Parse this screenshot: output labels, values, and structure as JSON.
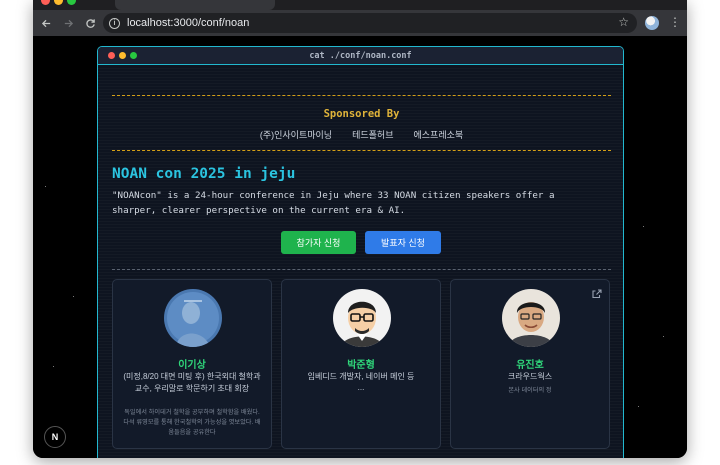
{
  "browser": {
    "url": "localhost:3000/conf/noan"
  },
  "terminal": {
    "title": "cat ./conf/noan.conf"
  },
  "sponsors": {
    "heading": "Sponsored By",
    "items": [
      "(주)인사이트마이닝",
      "테드폴허브",
      "에스프레소북"
    ]
  },
  "conference": {
    "title": "NOAN con 2025 in jeju",
    "description": "\"NOANcon\" is a 24-hour conference in Jeju where 33 NOAN citizen speakers offer a sharper, clearer perspective on the current era & AI."
  },
  "actions": {
    "attendee_label": "참가자 신청",
    "speaker_label": "발표자 신청"
  },
  "speakers": [
    {
      "name": "이기상",
      "role": "(미정,8/20 대면 미팅 후) 한국외대 철학과 교수, 우리말로 학문하기 초대 회장",
      "bio": "독일에서 하이데거 철학을 공부하며 철학함을 배웠다. 다석 류영모를 통해 한국철학의 가능성을 엿보았다. 배움들음을 공유한다"
    },
    {
      "name": "박준형",
      "role": "임베디드 개발자, 네이버 메인 등",
      "bio": "..."
    },
    {
      "name": "유진호",
      "role": "크라우드웍스",
      "bio": "본사 데이터의 정"
    }
  ],
  "devtools": {
    "badge": "N"
  },
  "colors": {
    "accent_cyan": "#22b8cf",
    "sponsor_gold": "#e0b43a",
    "name_green": "#2fd67a",
    "button_green": "#1fb34d",
    "button_blue": "#2f7be8"
  }
}
